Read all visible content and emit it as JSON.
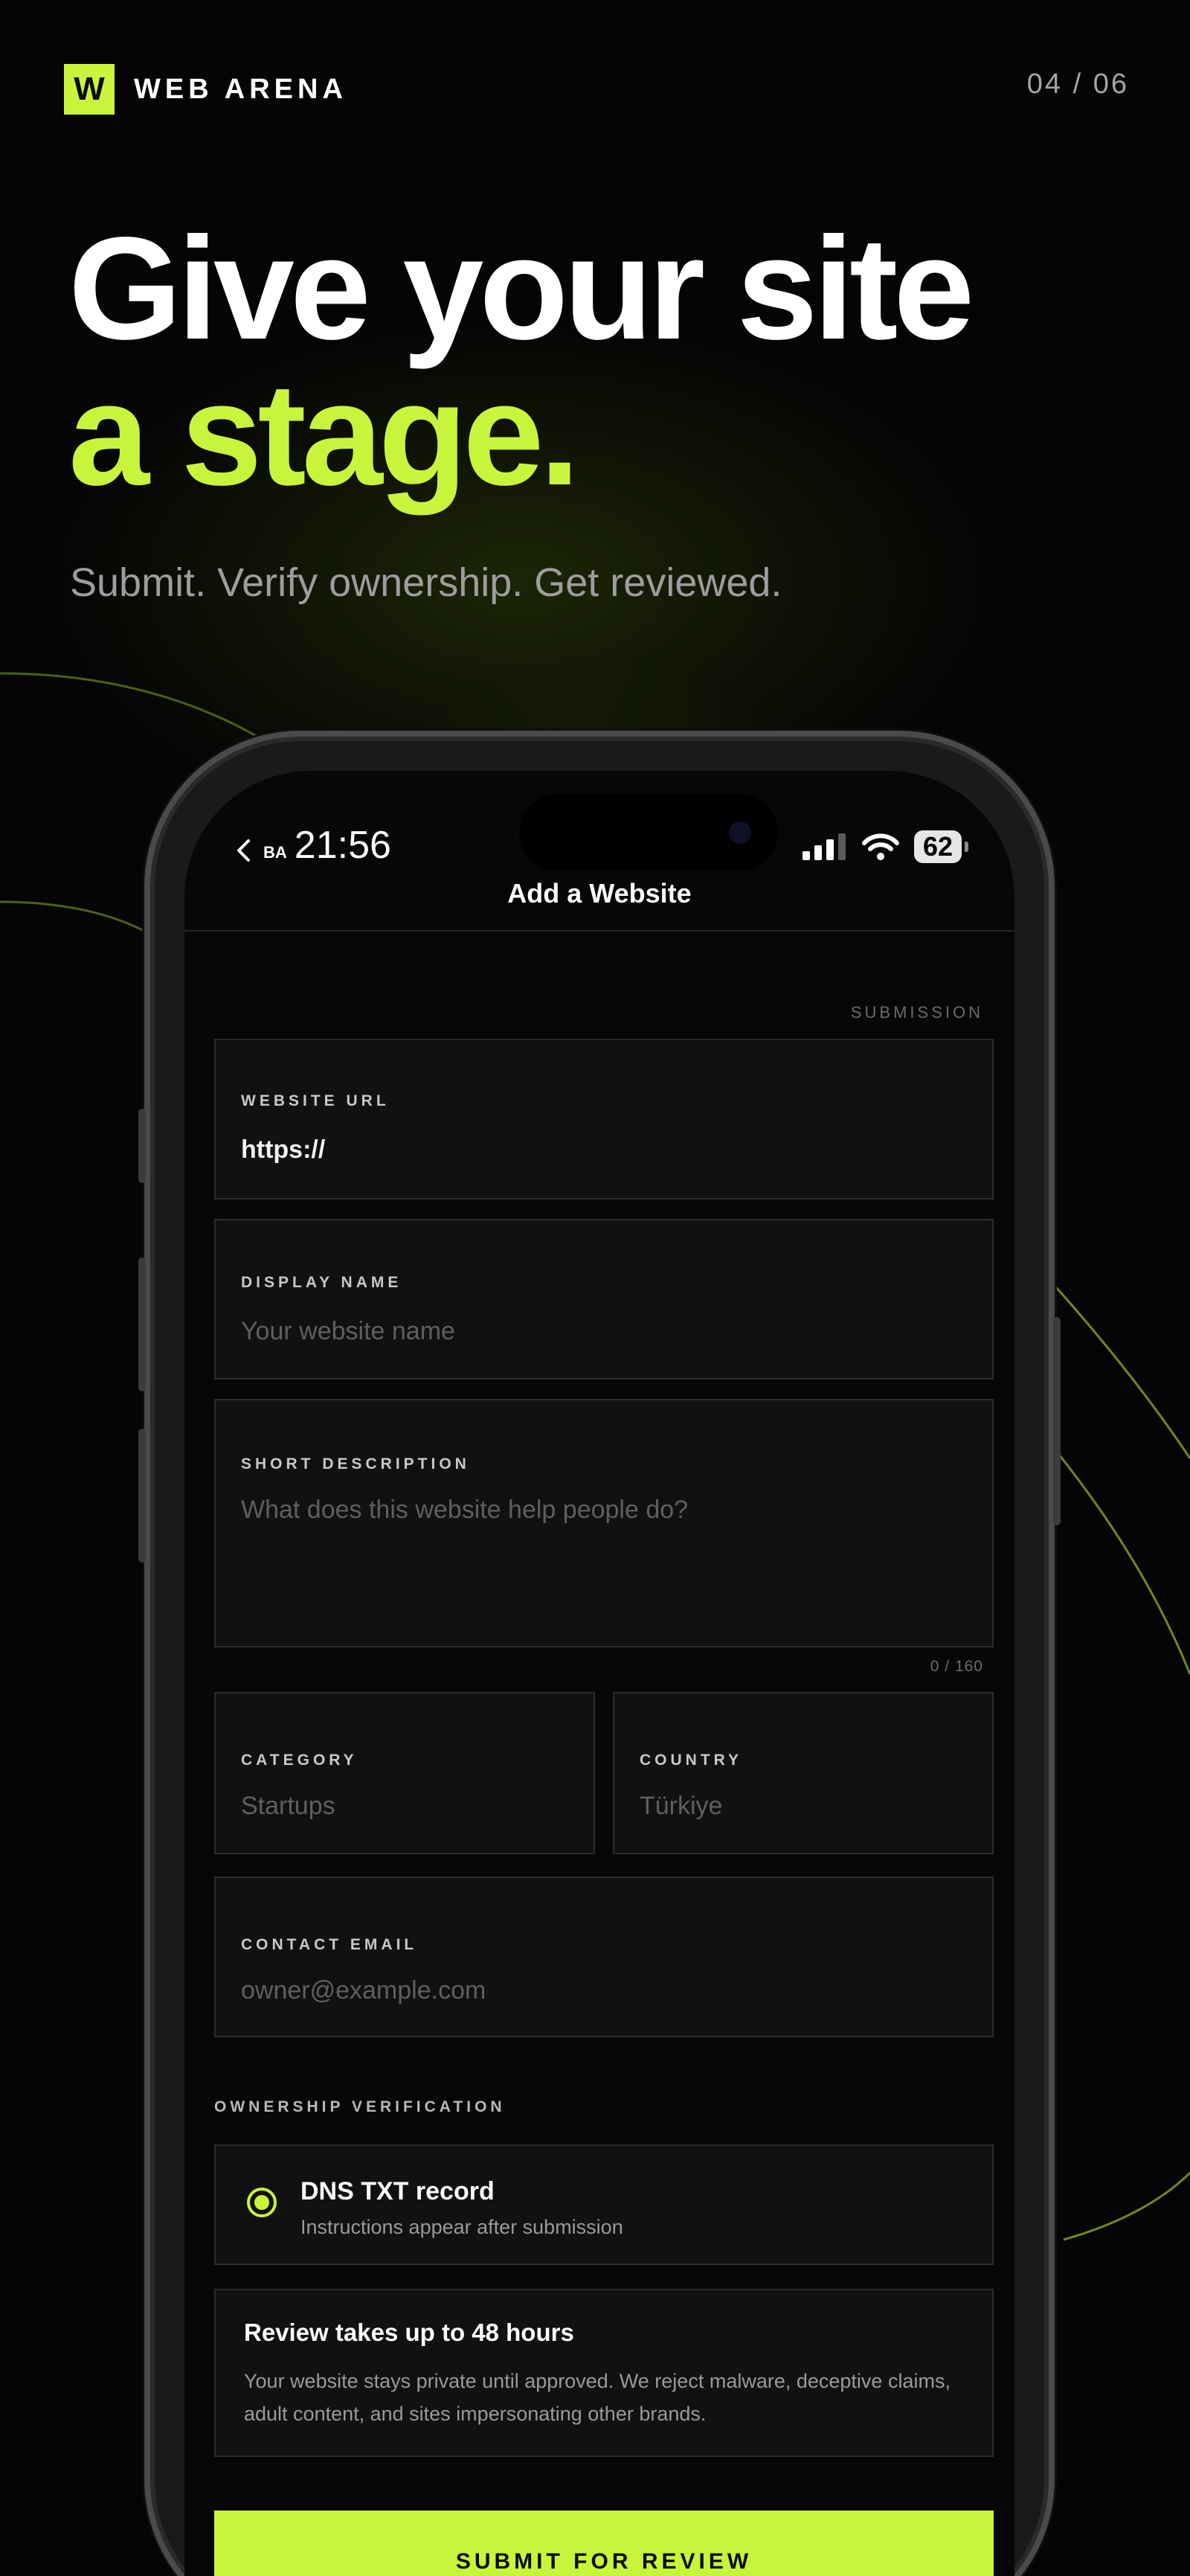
{
  "brand": {
    "logo_letter": "W",
    "name": "WEB ARENA"
  },
  "pager": "04 / 06",
  "headline": {
    "line1": "Give your site",
    "line2": "a stage."
  },
  "subhead": "Submit. Verify ownership. Get reviewed.",
  "colors": {
    "accent": "#c8f53c",
    "background": "#050505",
    "field_bg": "#111111"
  },
  "phone": {
    "status": {
      "back_app": "BA",
      "time": "21:56",
      "battery": "62"
    },
    "nav_title": "Add a Website",
    "section_tag": "SUBMISSION",
    "fields": {
      "url": {
        "label": "WEBSITE URL",
        "value": "https://"
      },
      "display_name": {
        "label": "DISPLAY NAME",
        "placeholder": "Your website name"
      },
      "description": {
        "label": "SHORT DESCRIPTION",
        "placeholder": "What does this website help people do?",
        "counter": "0 / 160"
      },
      "category": {
        "label": "CATEGORY",
        "value": "Startups"
      },
      "country": {
        "label": "COUNTRY",
        "value": "Türkiye"
      },
      "email": {
        "label": "CONTACT EMAIL",
        "placeholder": "owner@example.com"
      }
    },
    "verification": {
      "label": "OWNERSHIP VERIFICATION",
      "option_title": "DNS TXT record",
      "option_subtitle": "Instructions appear after submission"
    },
    "notice": {
      "title": "Review takes up to 48 hours",
      "body": "Your website stays private until approved. We reject malware, deceptive claims, adult content, and sites impersonating other brands."
    },
    "submit_label": "SUBMIT FOR REVIEW"
  }
}
